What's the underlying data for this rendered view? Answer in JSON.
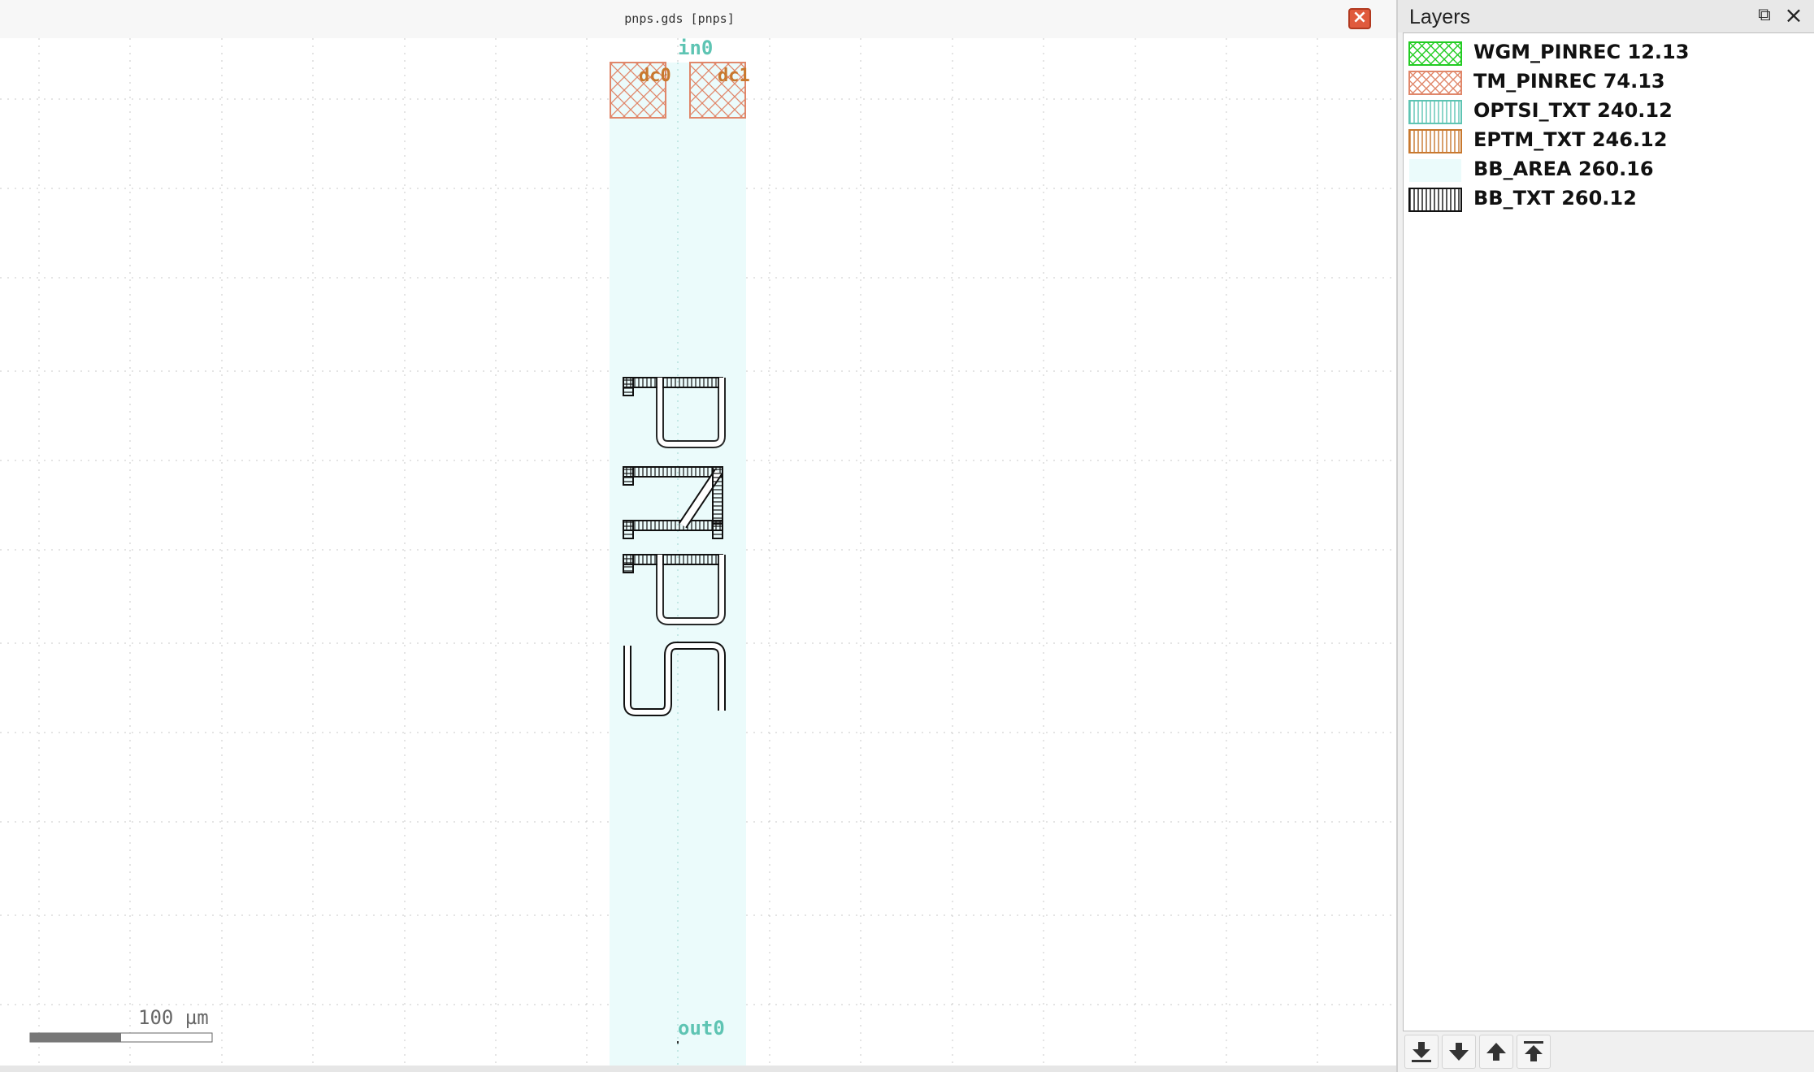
{
  "view": {
    "title": "pnps.gds [pnps]",
    "close_icon": "close-x-icon",
    "ports": {
      "in": "in0",
      "out": "out0",
      "dc0": "dc0",
      "dc1": "dc1"
    },
    "scale_bar": {
      "label": "100 µm"
    },
    "cell_text": "PNPS",
    "colors": {
      "bb_area": "#ebfbfb",
      "pin_text": "#5ec4b3",
      "dc_text": "#c8782e",
      "tm_pinrec": "#e0876a",
      "grid": "#c8c8c8",
      "close_button": "#e05a3d"
    }
  },
  "layers_panel": {
    "title": "Layers",
    "float_icon": "dock-float-icon",
    "close_icon": "dock-close-icon",
    "layers": [
      {
        "name": "WGM_PINREC 12.13",
        "pattern": "cross",
        "color": "#22cc22"
      },
      {
        "name": "TM_PINREC 74.13",
        "pattern": "cross",
        "color": "#e0876a"
      },
      {
        "name": "OPTSI_TXT 240.12",
        "pattern": "vlines",
        "color": "#5ec4b3"
      },
      {
        "name": "EPTM_TXT 246.12",
        "pattern": "vlines",
        "color": "#c8782e"
      },
      {
        "name": "BB_AREA 260.16",
        "pattern": "solid",
        "color": "#ebfbfb"
      },
      {
        "name": "BB_TXT 260.12",
        "pattern": "vlines",
        "color": "#111111"
      }
    ],
    "toolbar": [
      {
        "icon": "move-to-bottom-icon"
      },
      {
        "icon": "move-down-icon"
      },
      {
        "icon": "move-up-icon"
      },
      {
        "icon": "move-to-top-icon"
      }
    ]
  }
}
